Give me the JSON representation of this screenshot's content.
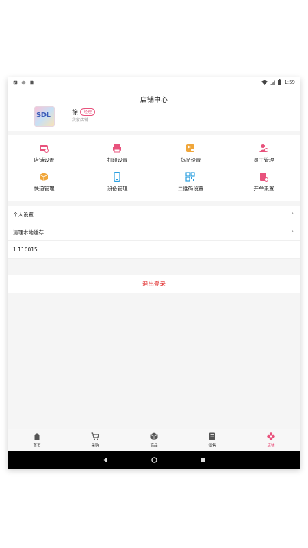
{
  "status_bar": {
    "time": "1:59"
  },
  "header": {
    "title": "店铺中心",
    "user_name": "徐",
    "role_badge": "经理",
    "shop_name": "我家店铺",
    "avatar_text": "SDL"
  },
  "grid": {
    "items": [
      {
        "label": "店铺设置",
        "icon": "shop-settings-icon",
        "color": "#e8537d"
      },
      {
        "label": "打印设置",
        "icon": "printer-icon",
        "color": "#e8537d"
      },
      {
        "label": "货品设置",
        "icon": "goods-settings-icon",
        "color": "#f0a63a"
      },
      {
        "label": "员工管理",
        "icon": "staff-icon",
        "color": "#e8537d"
      },
      {
        "label": "快递管理",
        "icon": "parcel-icon",
        "color": "#f0a63a"
      },
      {
        "label": "设备管理",
        "icon": "phone-icon",
        "color": "#2b9fe0"
      },
      {
        "label": "二维码设置",
        "icon": "qrcode-icon",
        "color": "#2b9fe0"
      },
      {
        "label": "开单设置",
        "icon": "order-icon",
        "color": "#e8537d"
      }
    ]
  },
  "list": {
    "personal_settings": "个人设置",
    "clear_cache": "清理本地缓存",
    "version": "1.110015"
  },
  "logout_label": "退出登录",
  "tabbar": {
    "tabs": [
      {
        "label": "首页",
        "icon": "home-icon"
      },
      {
        "label": "采购",
        "icon": "cart-icon"
      },
      {
        "label": "商品",
        "icon": "box-icon"
      },
      {
        "label": "销售",
        "icon": "sales-doc-icon"
      },
      {
        "label": "店铺",
        "icon": "flower-icon",
        "active": true
      }
    ],
    "active_color": "#e8537d"
  }
}
